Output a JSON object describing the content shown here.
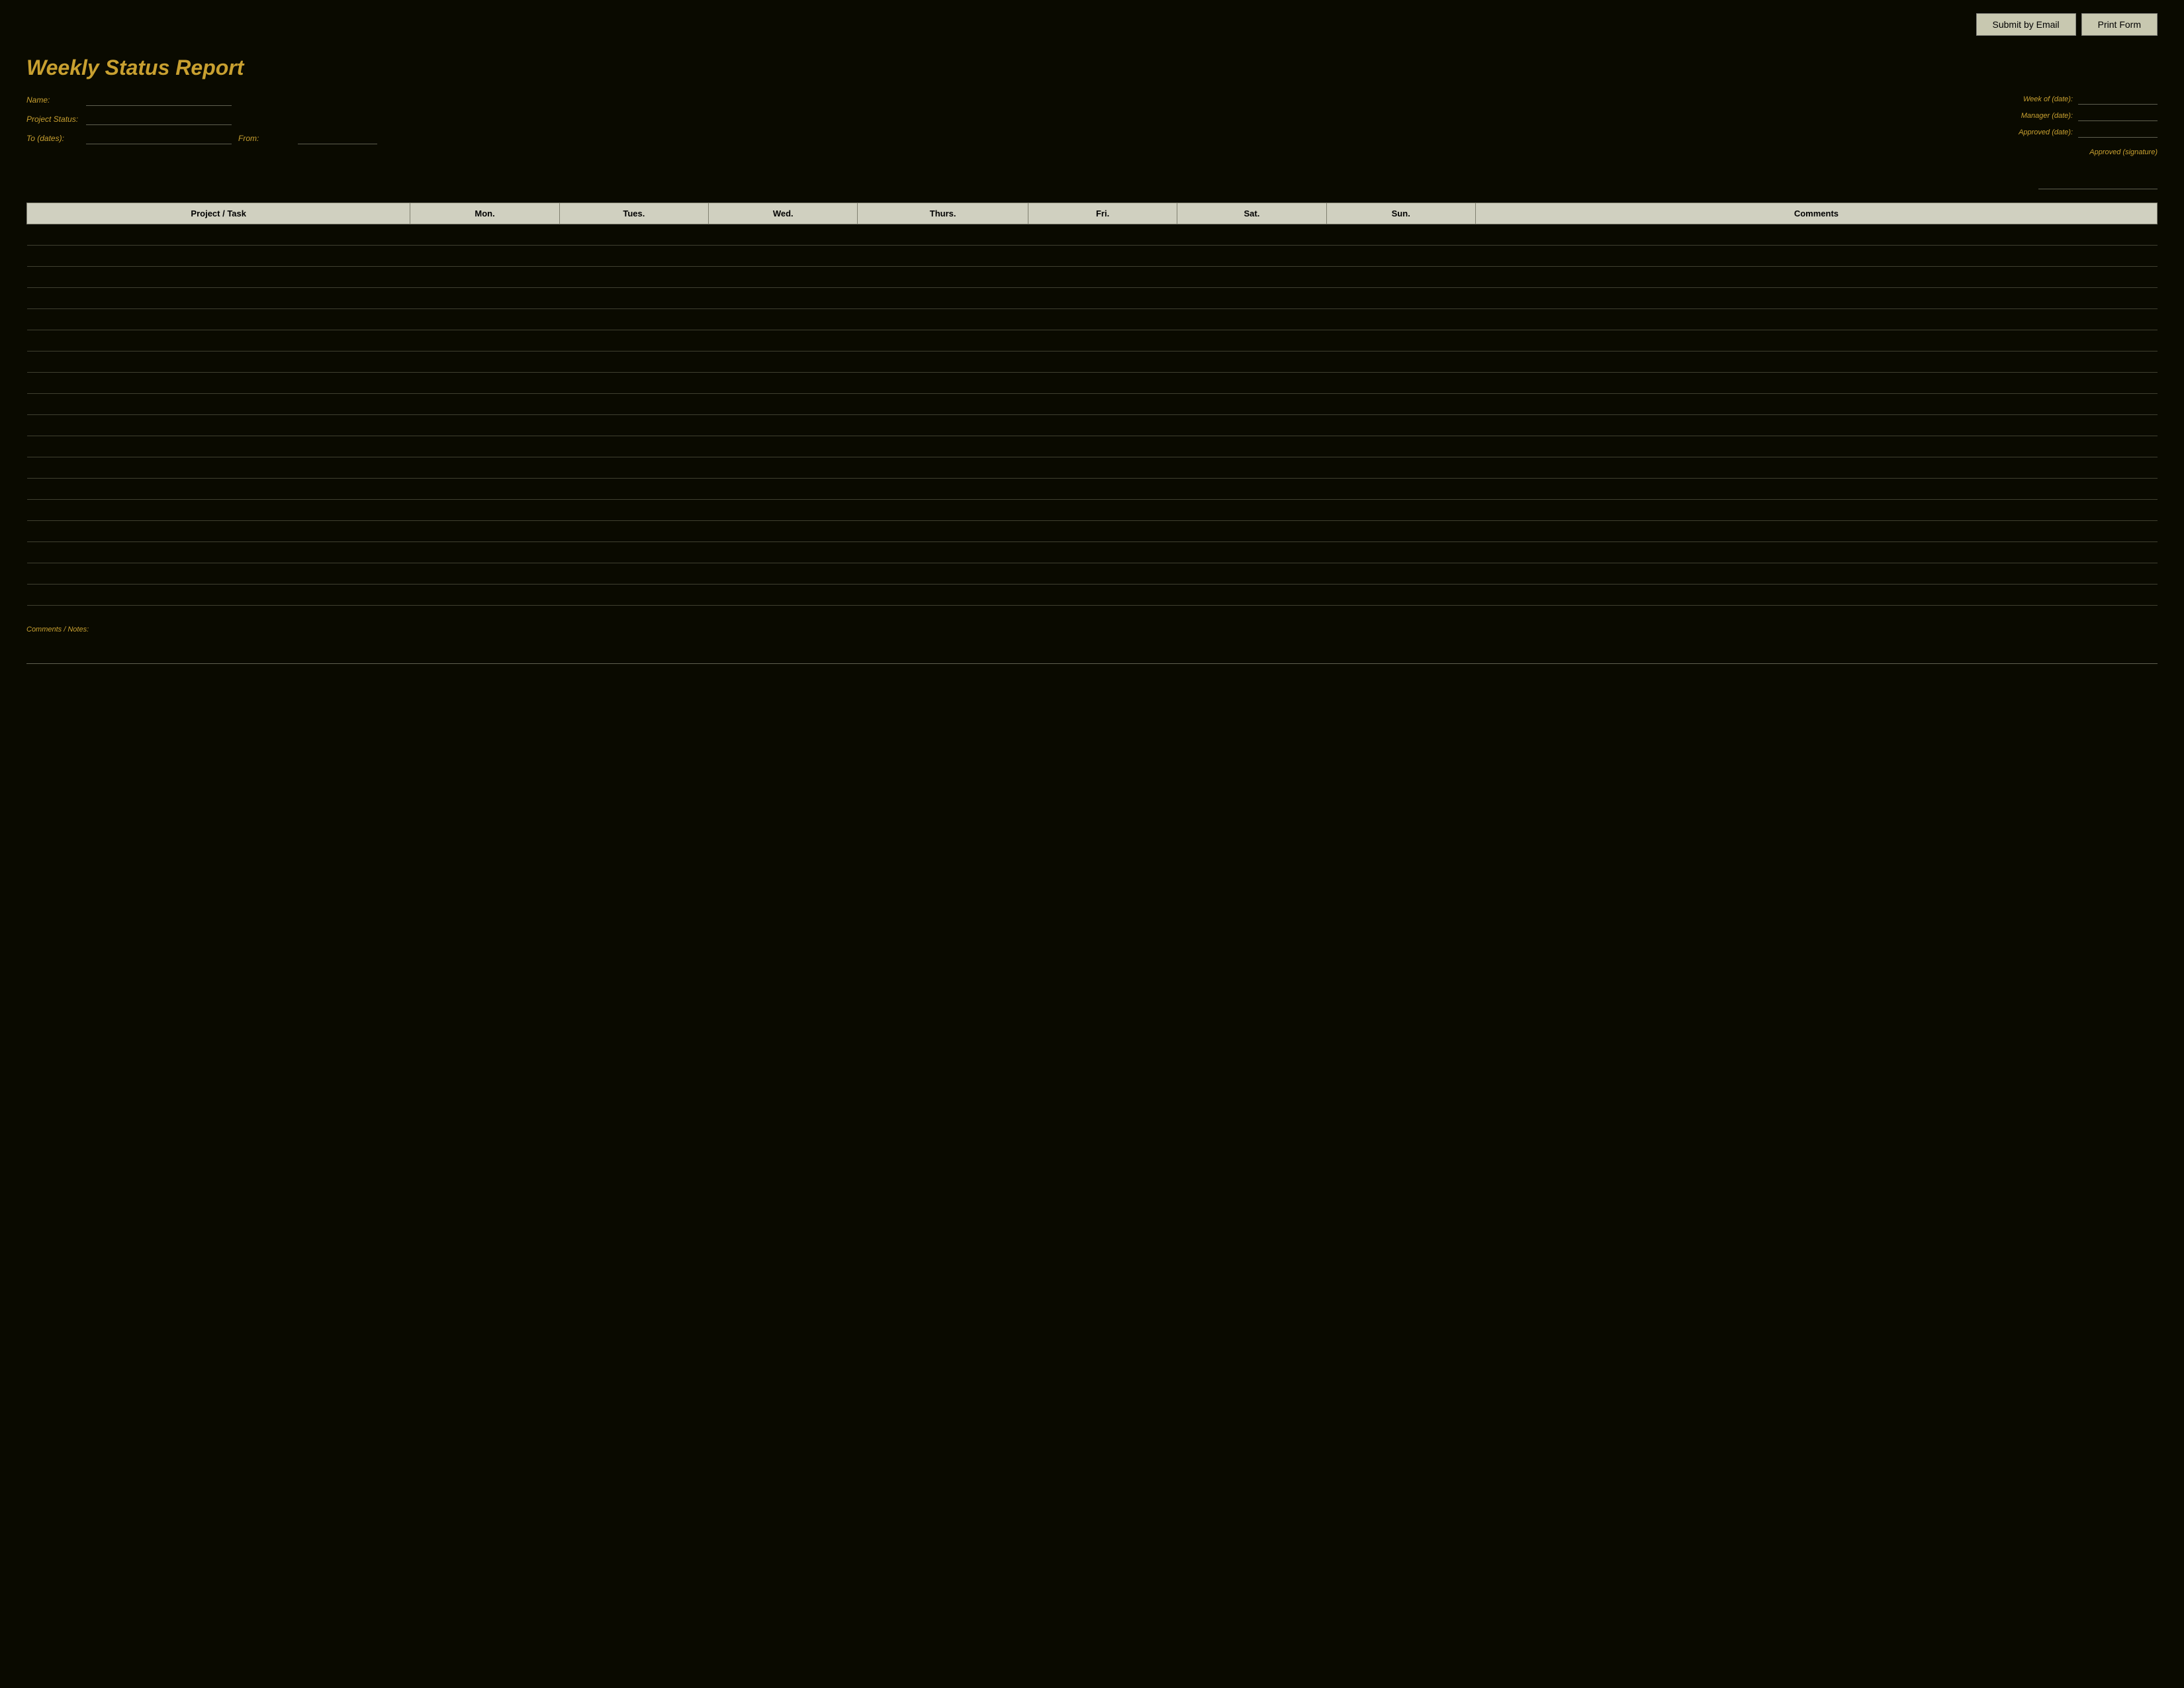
{
  "topBar": {
    "submitEmailLabel": "Submit by Email",
    "printFormLabel": "Print Form"
  },
  "title": "Weekly Status Report",
  "headerLeft": {
    "nameLabel": "Name:",
    "namePlaceholder": "",
    "projectStatusLabel": "Project Status:",
    "projectStatusPlaceholder": "",
    "toDateLabel": "To (dates):",
    "toDatePlaceholder": "",
    "fromLabel": "From:",
    "fromPlaceholder": ""
  },
  "headerRight": {
    "weekOfLabel": "Week of (date):",
    "weekOfPlaceholder": "",
    "managerLabel": "Manager (date):",
    "managerPlaceholder": "",
    "approvedLabel": "Approved (date):",
    "approvedPlaceholder": "",
    "signatureLabel": "Approved (signature)"
  },
  "table": {
    "columns": [
      "Project / Task",
      "Mon.",
      "Tues.",
      "Wed.",
      "Thurs.",
      "Fri.",
      "Sat.",
      "Sun.",
      "Comments"
    ],
    "rowCount": 18
  },
  "footer": {
    "commentsLabel": "Comments / Notes:"
  }
}
